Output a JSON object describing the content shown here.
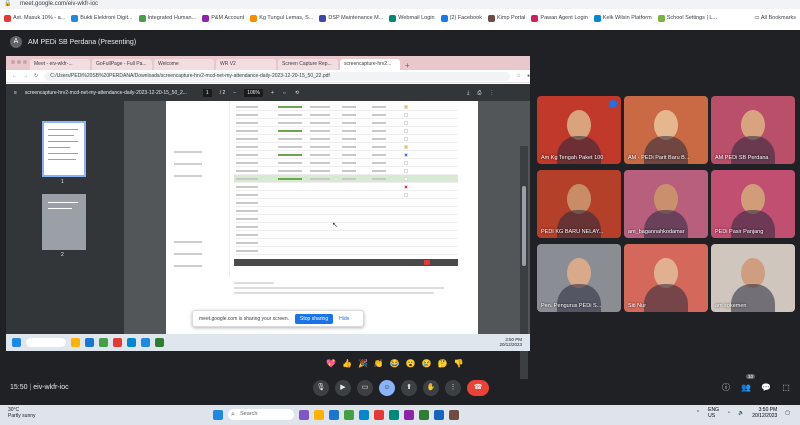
{
  "browser": {
    "url": "meet.google.com/eiv-wkfr-ioc",
    "bookmarks": [
      "Ast. Masuk 10% - a...",
      "Bukti Elektroni Digit...",
      "Integrated Human...",
      "P&M Account",
      "Kg Tungul Lemas, S...",
      "DSP Maintenance M...",
      "Webmail Login",
      "(2) Facebook",
      "Kimp Portal",
      "Pawan Agent Login",
      "Kelk Wilsin Platform",
      "School Settings | L..."
    ],
    "all_bookmarks": "All Bookmarks"
  },
  "meet": {
    "presenter_title": "AM PEDi SB Perdana (Presenting)",
    "meeting_code": "eiv-wkfr-ioc",
    "clock": "15:50",
    "badge_count": "10",
    "reactions": [
      "💖",
      "👍",
      "🎉",
      "👏",
      "😂",
      "😮",
      "😢",
      "🤔",
      "👎"
    ],
    "controls": [
      "mic-icon",
      "camera-icon",
      "captions-icon",
      "emoji-icon",
      "present-icon",
      "raise-hand-icon",
      "more-icon",
      "end-call-icon"
    ]
  },
  "shared": {
    "tabs": [
      "Meet - eiv-wkfr-...",
      "GoFullPage - Full Pa...",
      "Welcome",
      "WR V2",
      "Screen Capture Rep...",
      "screencapture-hrv2..."
    ],
    "pdf_url": "C:/Users/PEDi%20SB%20PERDANA/Downloads/screencapture-hrv2-mcd-net-my-attendance-daily-2023-12-20-15_50_22.pdf",
    "pdf_name": "screencapture-hrv2-mcd-net-my-attendance-daily-2023-12-20-15_50_2...",
    "page_current": "1",
    "page_total": "/ 2",
    "zoom": "106%",
    "thumbs": [
      "1",
      "2"
    ],
    "share_msg": "meet.google.com is sharing your screen.",
    "stop_sharing": "Stop sharing",
    "hide": "Hide",
    "inner_time": "3:50 PM",
    "inner_date": "20/12/2023",
    "inner_lang": "ENG\nUS"
  },
  "participants": [
    {
      "name": "Am Kg Tengah Paket 100",
      "bg": "#c0392b",
      "face": "#d9a37e"
    },
    {
      "name": "AM - PEDi Parit Baru B...",
      "bg": "#c96a45",
      "face": "#e6b68f"
    },
    {
      "name": "AM PEDi SB Perdana",
      "bg": "#b94f68",
      "face": "#d8a480"
    },
    {
      "name": "PEDI KG BARU NELAY...",
      "bg": "#b5402a",
      "face": "#c88d67"
    },
    {
      "name": "am_bagannahkodamar",
      "bg": "#b95f7e",
      "face": "#c9906d"
    },
    {
      "name": "PEDi Pasir Panjang",
      "bg": "#c04f72",
      "face": "#d19c78"
    },
    {
      "name": "Pen. Pengurus PEDi S...",
      "bg": "#8a8e94",
      "face": "#d8a98a"
    },
    {
      "name": "Siti Nur",
      "bg": "#d4685a",
      "face": "#e0b090"
    },
    {
      "name": "am sgkemen",
      "bg": "#cfc6bd",
      "face": "#cf9e80"
    }
  ],
  "taskbar": {
    "weather_temp": "30°C",
    "weather_desc": "Partly sunny",
    "search": "Search",
    "lang": "ENG\nUS",
    "time": "3:50 PM",
    "date": "20/12/2023"
  }
}
